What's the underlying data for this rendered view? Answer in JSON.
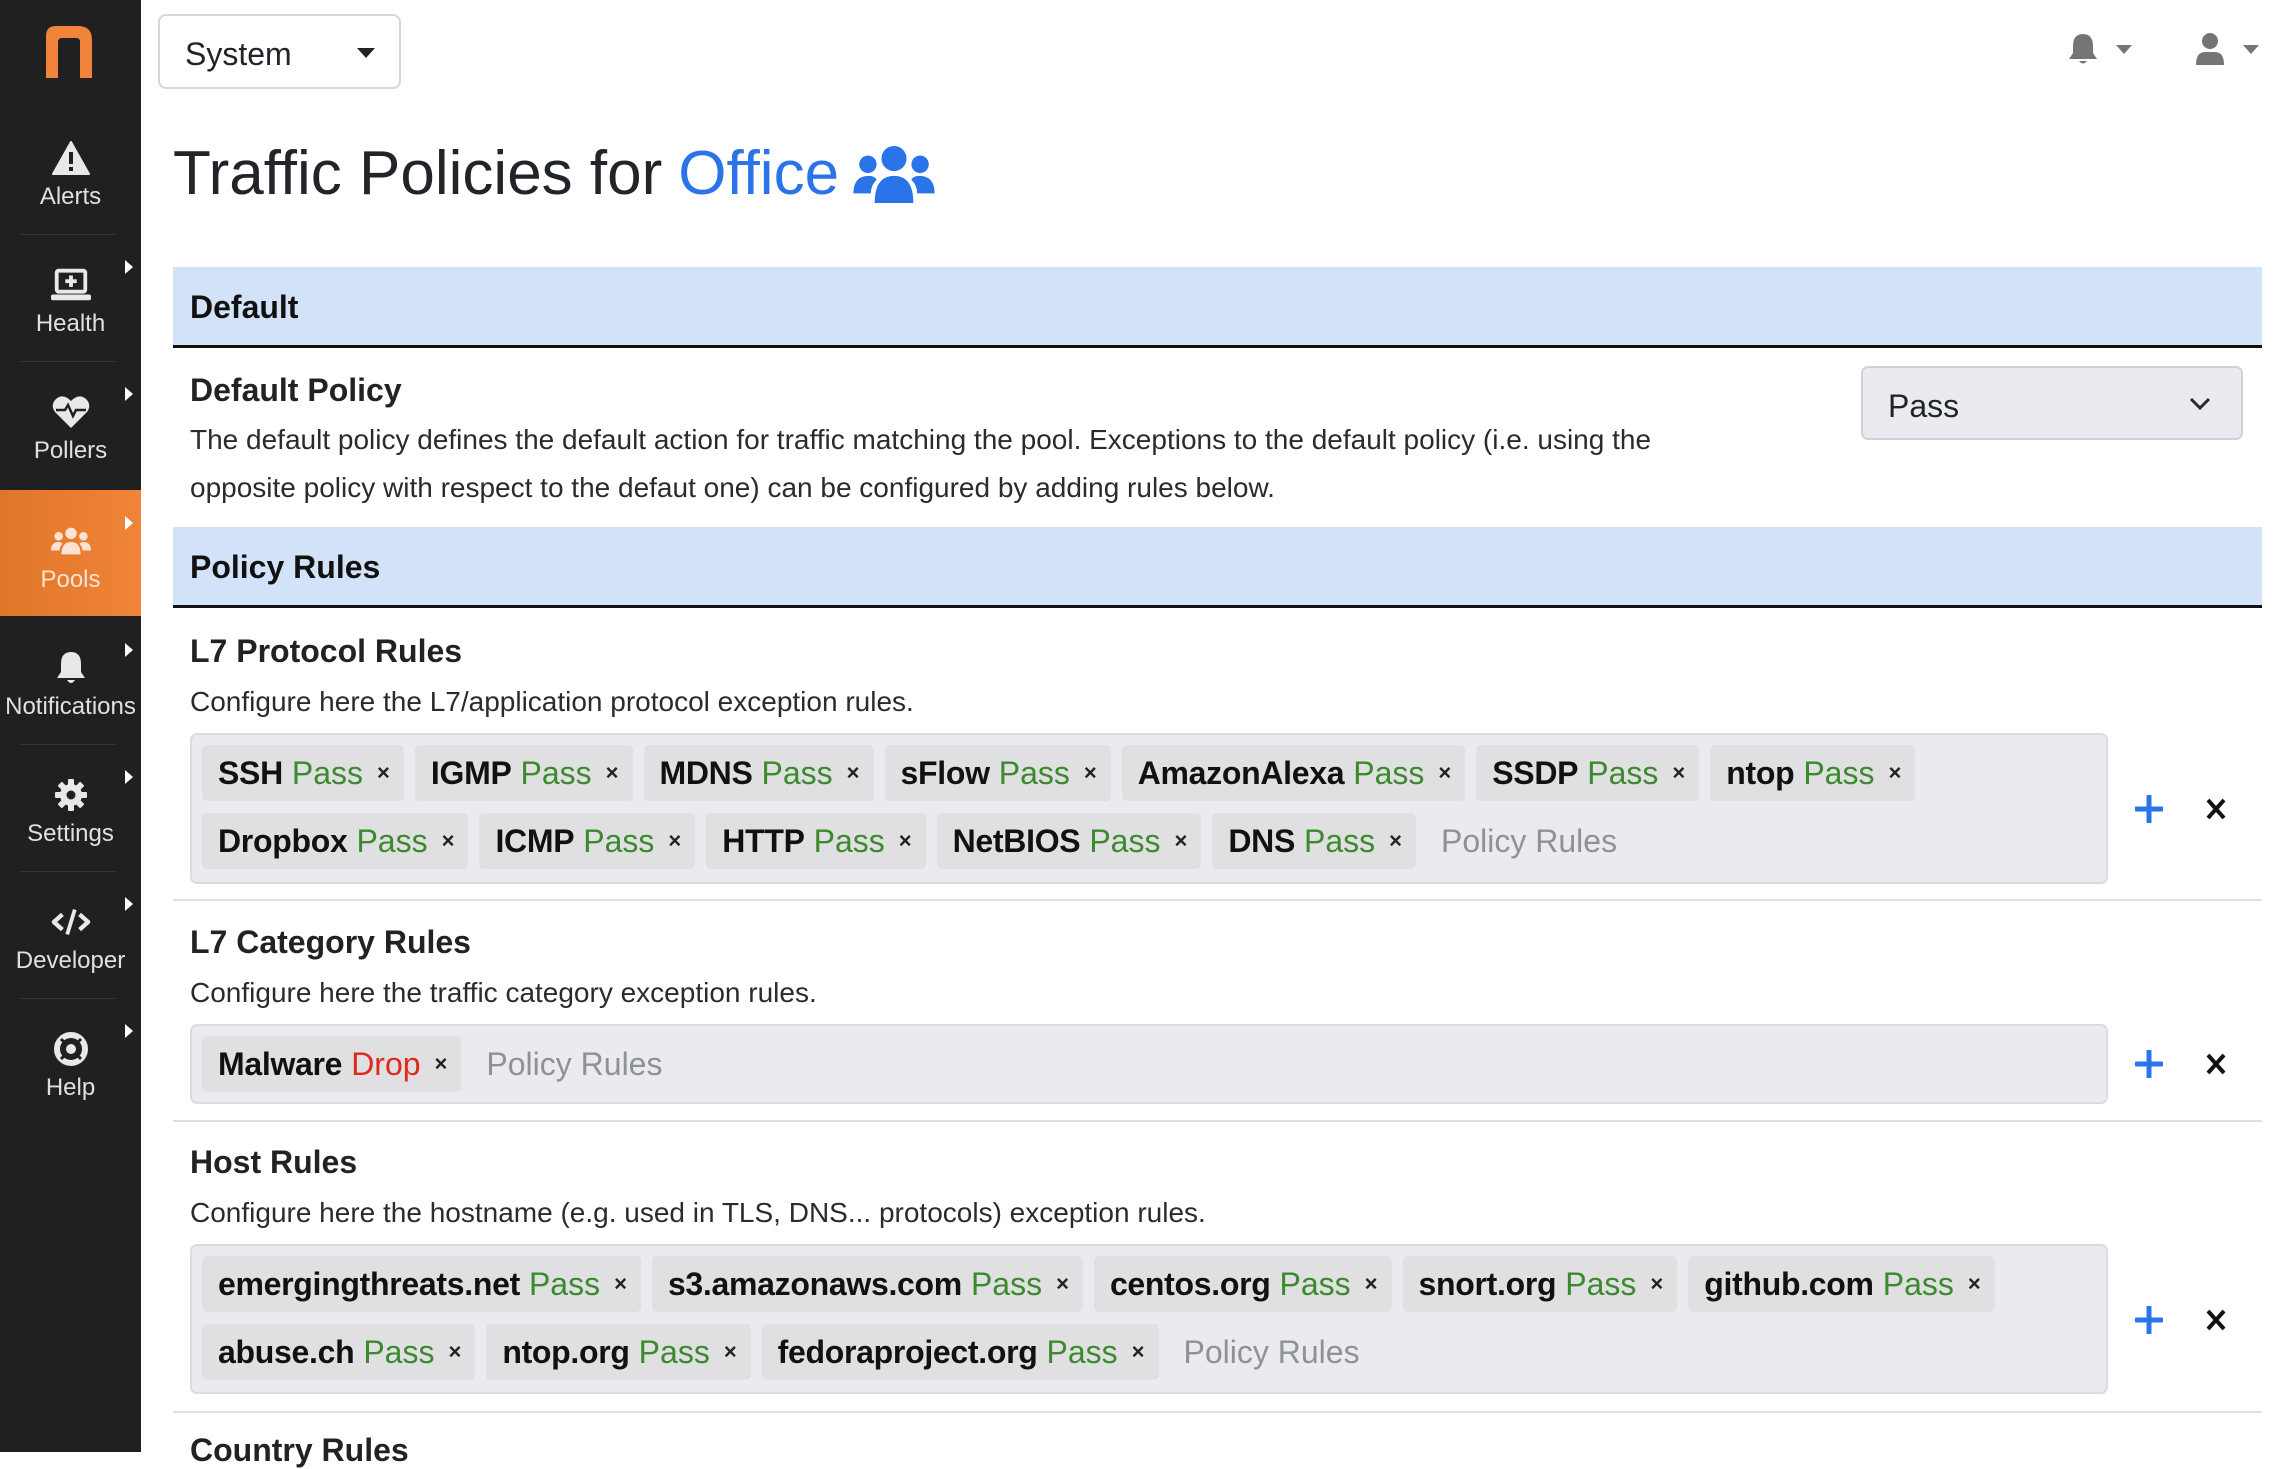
{
  "sidebar": {
    "logo": "n",
    "items": [
      {
        "label": "Alerts",
        "icon": "warning-triangle-icon",
        "has_submenu": false,
        "active": false
      },
      {
        "label": "Health",
        "icon": "laptop-medical-icon",
        "has_submenu": true,
        "active": false
      },
      {
        "label": "Pollers",
        "icon": "heartbeat-icon",
        "has_submenu": true,
        "active": false
      },
      {
        "label": "Pools",
        "icon": "users-icon",
        "has_submenu": true,
        "active": true
      },
      {
        "label": "Notifications",
        "icon": "bell-icon",
        "has_submenu": true,
        "active": false
      },
      {
        "label": "Settings",
        "icon": "gear-icon",
        "has_submenu": true,
        "active": false
      },
      {
        "label": "Developer",
        "icon": "code-icon",
        "has_submenu": true,
        "active": false
      },
      {
        "label": "Help",
        "icon": "life-ring-icon",
        "has_submenu": true,
        "active": false
      }
    ]
  },
  "topbar": {
    "context_select": "System",
    "notifications_icon": "bell-icon",
    "user_icon": "user-icon"
  },
  "page": {
    "title_prefix": "Traffic Policies for",
    "pool_name": "Office",
    "title_icon": "users-icon"
  },
  "colors": {
    "accent": "#2a73e8",
    "brand": "#f0843a",
    "pass": "#3b8a2e",
    "drop": "#e0281d",
    "section_header_bg": "#d2e2f8"
  },
  "default_section": {
    "header": "Default",
    "policy_label": "Default Policy",
    "description_line1": "The default policy defines the default action for traffic matching the pool. Exceptions to the default policy (i.e. using the",
    "description_line2": "opposite policy with respect to the defaut one) can be configured by adding rules below.",
    "policy_value": "Pass"
  },
  "rules_section": {
    "header": "Policy Rules",
    "groups": [
      {
        "title": "L7 Protocol Rules",
        "description": "Configure here the L7/application protocol exception rules.",
        "placeholder": "Policy Rules",
        "tags": [
          {
            "name": "SSH",
            "action": "Pass"
          },
          {
            "name": "IGMP",
            "action": "Pass"
          },
          {
            "name": "MDNS",
            "action": "Pass"
          },
          {
            "name": "sFlow",
            "action": "Pass"
          },
          {
            "name": "AmazonAlexa",
            "action": "Pass"
          },
          {
            "name": "SSDP",
            "action": "Pass"
          },
          {
            "name": "ntop",
            "action": "Pass"
          },
          {
            "name": "Dropbox",
            "action": "Pass"
          },
          {
            "name": "ICMP",
            "action": "Pass"
          },
          {
            "name": "HTTP",
            "action": "Pass"
          },
          {
            "name": "NetBIOS",
            "action": "Pass"
          },
          {
            "name": "DNS",
            "action": "Pass"
          }
        ]
      },
      {
        "title": "L7 Category Rules",
        "description": "Configure here the traffic category exception rules.",
        "placeholder": "Policy Rules",
        "tags": [
          {
            "name": "Malware",
            "action": "Drop"
          }
        ]
      },
      {
        "title": "Host Rules",
        "description": "Configure here the hostname (e.g. used in TLS, DNS... protocols) exception rules.",
        "placeholder": "Policy Rules",
        "tags": [
          {
            "name": "emergingthreats.net",
            "action": "Pass"
          },
          {
            "name": "s3.amazonaws.com",
            "action": "Pass"
          },
          {
            "name": "centos.org",
            "action": "Pass"
          },
          {
            "name": "snort.org",
            "action": "Pass"
          },
          {
            "name": "github.com",
            "action": "Pass"
          },
          {
            "name": "abuse.ch",
            "action": "Pass"
          },
          {
            "name": "ntop.org",
            "action": "Pass"
          },
          {
            "name": "fedoraproject.org",
            "action": "Pass"
          }
        ]
      },
      {
        "title": "Country Rules"
      }
    ],
    "remove_tag_glyph": "×",
    "add_icon": "plus-icon",
    "clear_icon": "close-icon"
  }
}
